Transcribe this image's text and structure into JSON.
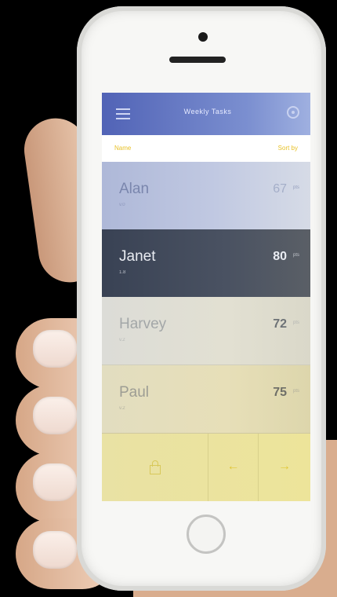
{
  "header": {
    "title": "Weekly Tasks"
  },
  "subheader": {
    "left": "Name",
    "right": "Sort by"
  },
  "people": [
    {
      "name": "Alan",
      "detail": "v.0",
      "value": "67",
      "unit": "pts"
    },
    {
      "name": "Janet",
      "detail": "1.8",
      "value": "80",
      "unit": "pts"
    },
    {
      "name": "Harvey",
      "detail": "v.2",
      "value": "72",
      "unit": "pts"
    },
    {
      "name": "Paul",
      "detail": "v.2",
      "value": "75",
      "unit": "pts"
    }
  ],
  "footer": {
    "left_arrow": "←",
    "right_arrow": "→"
  },
  "colors": {
    "topbar": "#5163b6",
    "accent": "#e8c22a",
    "selected_row": "#394254"
  }
}
